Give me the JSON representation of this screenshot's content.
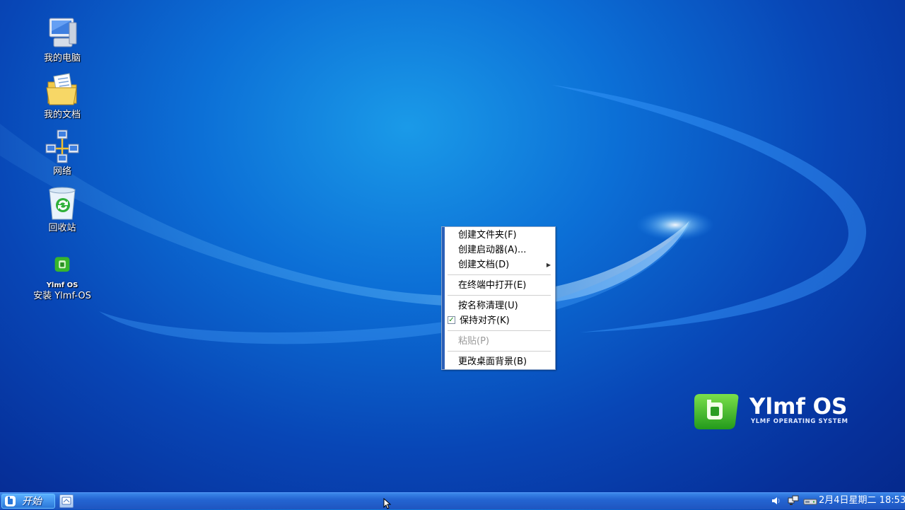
{
  "desktop": {
    "icons": [
      {
        "label": "我的电脑",
        "icon": "my-computer-icon"
      },
      {
        "label": "我的文档",
        "icon": "my-documents-icon"
      },
      {
        "label": "网络",
        "icon": "network-icon"
      },
      {
        "label": "回收站",
        "icon": "recycle-bin-icon"
      },
      {
        "label": "安装 Ylmf-OS",
        "icon": "install-ylmf-icon",
        "badge_text": "Ylmf OS"
      }
    ],
    "logo": {
      "name": "Ylmf OS",
      "tagline": "YLMF OPERATING SYSTEM"
    }
  },
  "context_menu": {
    "items": [
      {
        "label": "创建文件夹(F)"
      },
      {
        "label": "创建启动器(A)..."
      },
      {
        "label": "创建文档(D)",
        "has_submenu": true
      },
      {
        "label": "在终端中打开(E)"
      },
      {
        "label": "按名称清理(U)"
      },
      {
        "label": "保持对齐(K)",
        "checked": true
      },
      {
        "label": "粘贴(P)",
        "disabled": true
      },
      {
        "label": "更改桌面背景(B)"
      }
    ]
  },
  "taskbar": {
    "start_label": "开始",
    "clock": "2月4日星期二 18:53",
    "tray_icons": [
      "volume-icon",
      "network-status-icon",
      "removable-drive-icon"
    ]
  },
  "colors": {
    "desktop_bg": "#0846b6",
    "taskbar": "#2465d2",
    "menu_stripe": "#2a5fb8",
    "logo_green": "#3cbf2a"
  }
}
